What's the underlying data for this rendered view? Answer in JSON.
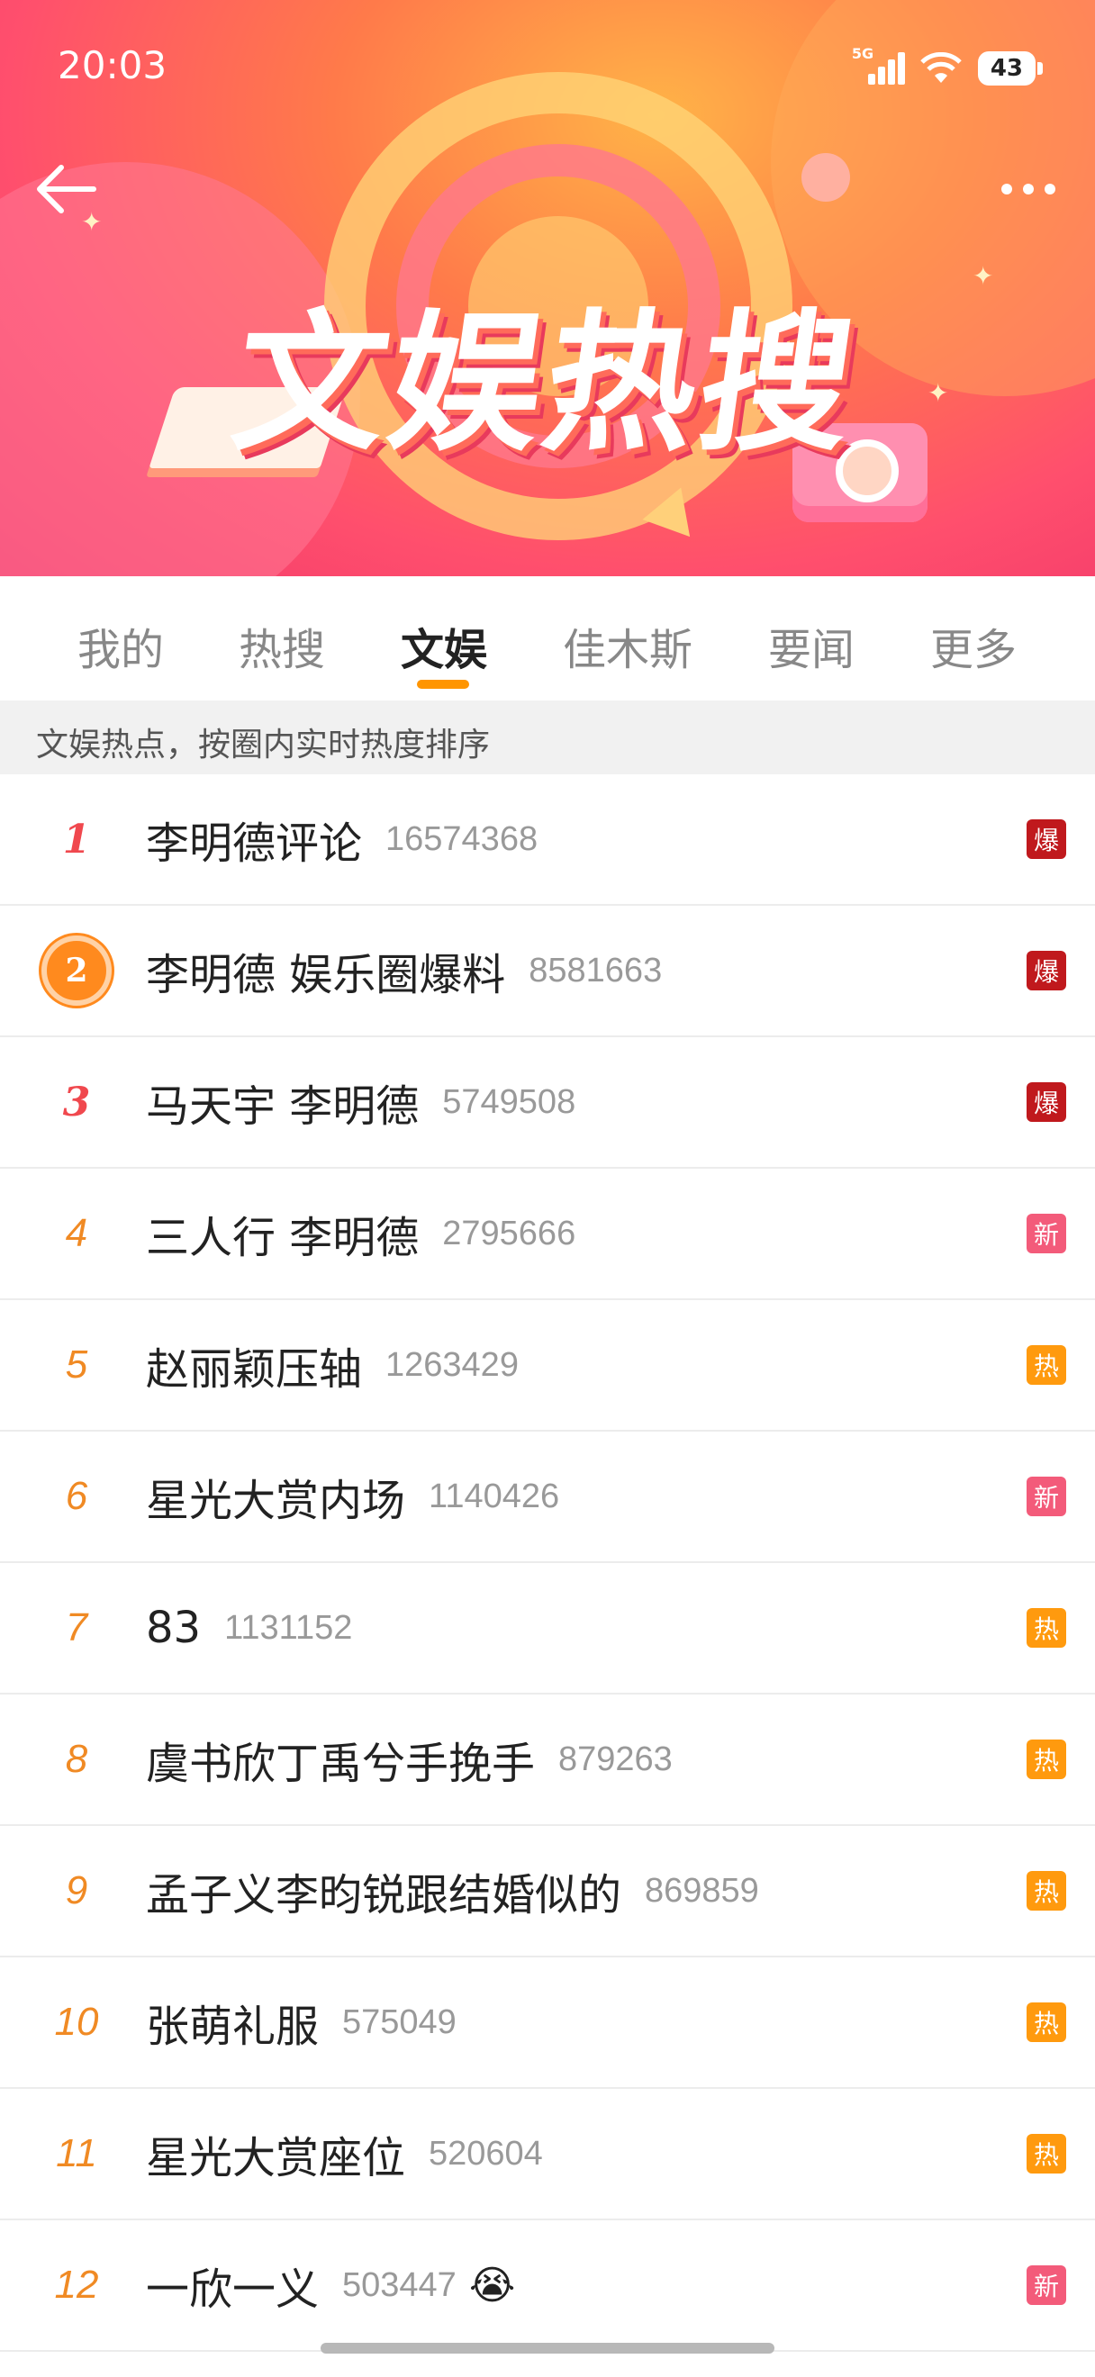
{
  "status_bar": {
    "time": "20:03",
    "network": "5G",
    "battery": "43"
  },
  "header": {
    "banner_title": "文娱热搜",
    "back_icon": "back-arrow-icon",
    "more_icon": "more-dots-icon"
  },
  "tabs": [
    {
      "label": "我的"
    },
    {
      "label": "热搜"
    },
    {
      "label": "文娱",
      "active": true
    },
    {
      "label": "佳木斯"
    },
    {
      "label": "要闻"
    },
    {
      "label": "更多"
    }
  ],
  "hint": "文娱热点，按圈内实时热度排序",
  "list": [
    {
      "rank": "1",
      "title": "李明德评论",
      "count": "16574368",
      "badge": "爆"
    },
    {
      "rank": "2",
      "title": "李明德 娱乐圈爆料",
      "count": "8581663",
      "badge": "爆"
    },
    {
      "rank": "3",
      "title": "马天宇 李明德",
      "count": "5749508",
      "badge": "爆"
    },
    {
      "rank": "4",
      "title": "三人行 李明德",
      "count": "2795666",
      "badge": "新"
    },
    {
      "rank": "5",
      "title": "赵丽颖压轴",
      "count": "1263429",
      "badge": "热"
    },
    {
      "rank": "6",
      "title": "星光大赏内场",
      "count": "1140426",
      "badge": "新"
    },
    {
      "rank": "7",
      "title": "83",
      "count": "1131152",
      "badge": "热"
    },
    {
      "rank": "8",
      "title": "虞书欣丁禹兮手挽手",
      "count": "879263",
      "badge": "热"
    },
    {
      "rank": "9",
      "title": "孟子义李昀锐跟结婚似的",
      "count": "869859",
      "badge": "热"
    },
    {
      "rank": "10",
      "title": "张萌礼服",
      "count": "575049",
      "badge": "热"
    },
    {
      "rank": "11",
      "title": "星光大赏座位",
      "count": "520604",
      "badge": "热"
    },
    {
      "rank": "12",
      "title": "一欣一义",
      "count": "503447",
      "badge": "新",
      "emoji": "😭"
    }
  ],
  "colors": {
    "accent": "#ff9500",
    "rank_top": "#f0484e",
    "rank_other": "#f08a24",
    "badge_bao": "#c0191d",
    "badge_xin": "#f35b7a",
    "badge_re": "#ff9a0e"
  }
}
